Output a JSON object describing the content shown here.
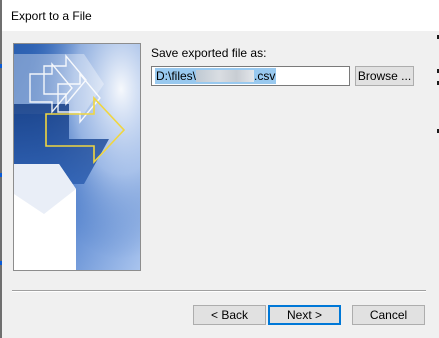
{
  "window": {
    "title": "Export to a File"
  },
  "form": {
    "save_label": "Save exported file as:",
    "path_prefix": "D:\\files\\",
    "path_suffix": ".csv",
    "browse_label": "Browse ..."
  },
  "footer": {
    "back_label": "< Back",
    "next_label": "Next >",
    "cancel_label": "Cancel"
  },
  "colors": {
    "accent": "#0078d7",
    "selection": "#99c9ef",
    "dialog_background": "#f0f0f0",
    "art_blue_dark": "#1f4f9f",
    "art_blue_light": "#8fb4ea",
    "art_arrow_yellow": "#e8d24a"
  }
}
